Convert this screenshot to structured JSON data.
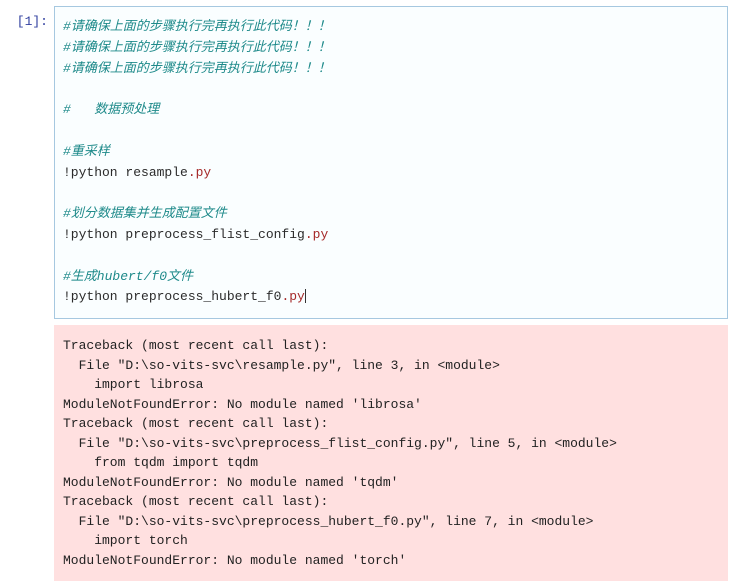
{
  "cell": {
    "prompt": "[1]:",
    "code": {
      "l1": "#请确保上面的步骤执行完再执行此代码！！！",
      "l2": "#请确保上面的步骤执行完再执行此代码！！！",
      "l3": "#请确保上面的步骤执行完再执行此代码！！！",
      "l4": "",
      "l5": "#   数据预处理",
      "l6": "",
      "l7": "#重采样",
      "l8_pre": "!python resample",
      "l8_ext": ".py",
      "l9": "",
      "l10": "#划分数据集并生成配置文件",
      "l11_pre": "!python preprocess_flist_config",
      "l11_ext": ".py",
      "l12": "",
      "l13": "#生成hubert/f0文件",
      "l14_pre": "!python preprocess_hubert_f0",
      "l14_ext": ".py"
    },
    "output": "Traceback (most recent call last):\n  File \"D:\\so-vits-svc\\resample.py\", line 3, in <module>\n    import librosa\nModuleNotFoundError: No module named 'librosa'\nTraceback (most recent call last):\n  File \"D:\\so-vits-svc\\preprocess_flist_config.py\", line 5, in <module>\n    from tqdm import tqdm\nModuleNotFoundError: No module named 'tqdm'\nTraceback (most recent call last):\n  File \"D:\\so-vits-svc\\preprocess_hubert_f0.py\", line 7, in <module>\n    import torch\nModuleNotFoundError: No module named 'torch'"
  }
}
